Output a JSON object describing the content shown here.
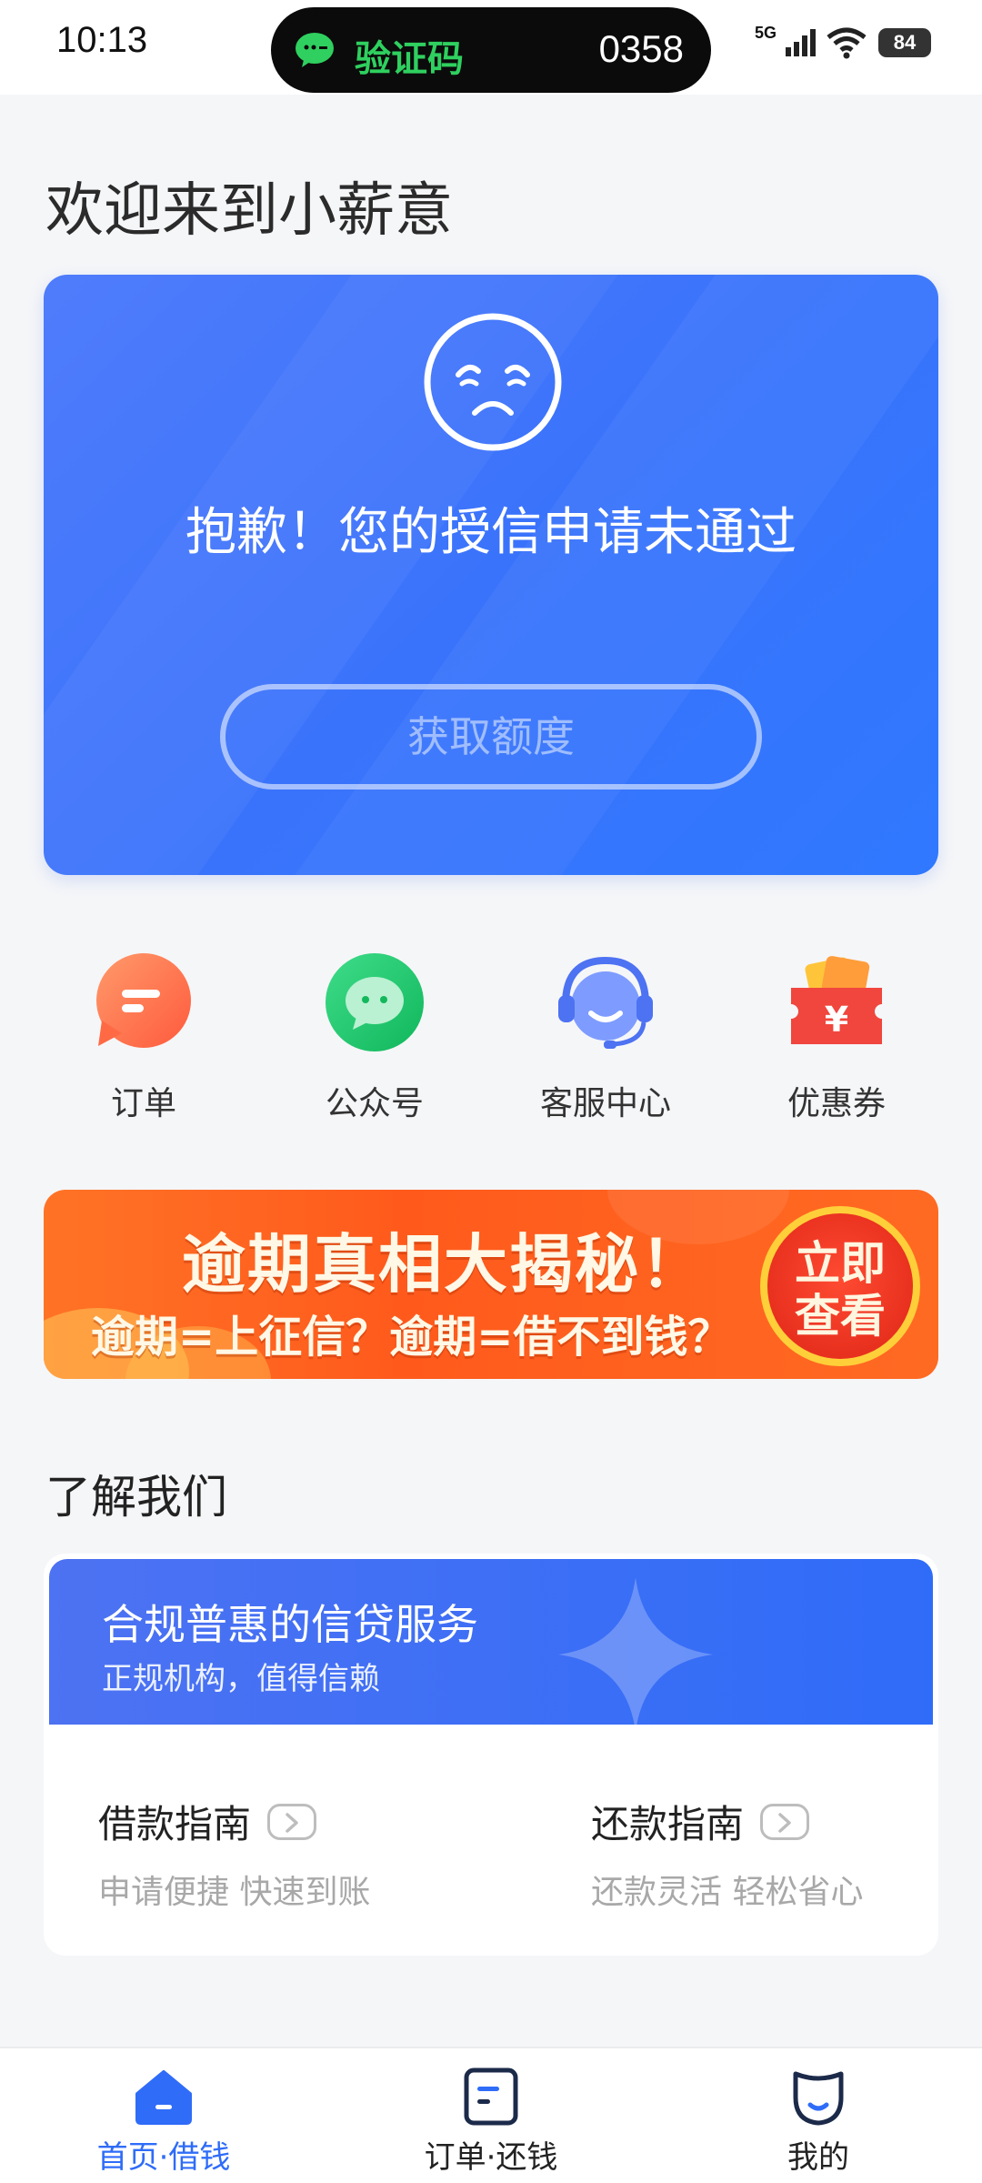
{
  "status_bar": {
    "time": "10:13",
    "notification": {
      "app_icon": "wechat-icon",
      "label": "验证码",
      "code": "0358"
    },
    "network_label": "5G",
    "battery_level": "84"
  },
  "page": {
    "welcome_title": "欢迎来到小薪意"
  },
  "credit_card": {
    "icon": "sad-face-icon",
    "message": "抱歉！您的授信申请未通过",
    "button_label": "获取额度"
  },
  "quick_actions": [
    {
      "label": "订单",
      "icon": "order-icon"
    },
    {
      "label": "公众号",
      "icon": "wechat-official-icon"
    },
    {
      "label": "客服中心",
      "icon": "customer-service-icon"
    },
    {
      "label": "优惠券",
      "icon": "coupon-icon"
    }
  ],
  "promo": {
    "title": "逾期真相大揭秘！",
    "subtitle": "逾期=上征信？逾期=借不到钱？",
    "cta_line1": "立即",
    "cta_line2": "查看"
  },
  "about": {
    "section_title": "了解我们",
    "header_title": "合规普惠的信贷服务",
    "header_subtitle": "正规机构，值得信赖",
    "guides": [
      {
        "title": "借款指南",
        "subtitle": "申请便捷 快速到账"
      },
      {
        "title": "还款指南",
        "subtitle": "还款灵活 轻松省心"
      }
    ]
  },
  "bottom_nav": [
    {
      "label": "首页·借钱",
      "icon": "home-icon",
      "active": true
    },
    {
      "label": "订单·还钱",
      "icon": "order-list-icon",
      "active": false
    },
    {
      "label": "我的",
      "icon": "profile-icon",
      "active": false
    }
  ],
  "colors": {
    "primary": "#2f6cf8",
    "promo_orange": "#ff5a1c",
    "wechat_green": "#2fd05f"
  }
}
